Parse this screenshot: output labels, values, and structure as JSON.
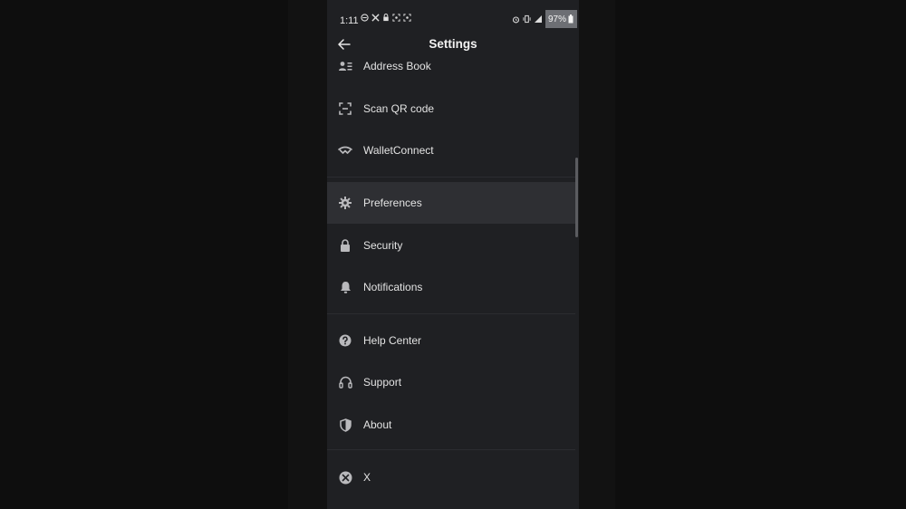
{
  "status_bar": {
    "time": "1:11",
    "battery": "97%"
  },
  "header": {
    "title": "Settings",
    "back_icon": "arrow-left-icon"
  },
  "menu": {
    "group1": [
      {
        "label": "Address Book",
        "icon": "contacts-icon"
      },
      {
        "label": "Scan QR code",
        "icon": "scan-qr-icon"
      },
      {
        "label": "WalletConnect",
        "icon": "walletconnect-icon"
      }
    ],
    "group2": [
      {
        "label": "Preferences",
        "icon": "gear-icon",
        "active": true
      },
      {
        "label": "Security",
        "icon": "lock-icon"
      },
      {
        "label": "Notifications",
        "icon": "bell-icon"
      }
    ],
    "group3": [
      {
        "label": "Help Center",
        "icon": "help-icon"
      },
      {
        "label": "Support",
        "icon": "headset-icon"
      },
      {
        "label": "About",
        "icon": "shield-icon"
      }
    ],
    "group4": [
      {
        "label": "X",
        "icon": "x-logo-icon"
      }
    ]
  },
  "colors": {
    "background": "#1f2023",
    "active_row": "#2e2f33",
    "text": "#e3e3e3"
  }
}
